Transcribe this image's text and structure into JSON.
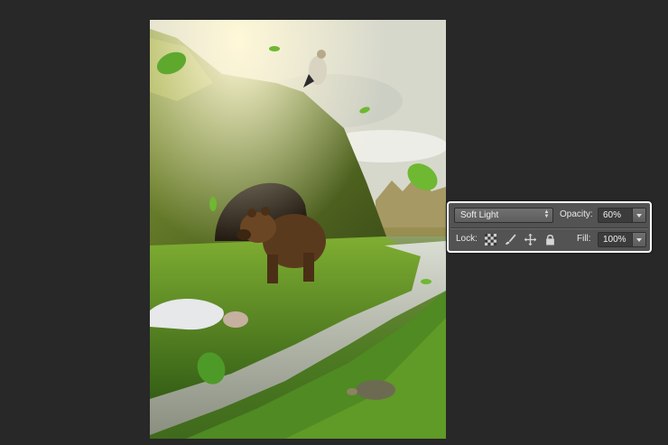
{
  "layers_panel": {
    "blend_mode": "Soft Light",
    "opacity_label": "Opacity:",
    "opacity_value": "60%",
    "lock_label": "Lock:",
    "fill_label": "Fill:",
    "fill_value": "100%",
    "lock_icons": [
      "transparency-lock-icon",
      "brush-lock-icon",
      "move-lock-icon",
      "padlock-icon"
    ]
  },
  "canvas_image": {
    "scene": [
      "mossy-rock-cave",
      "brown-bear",
      "bird-on-rock",
      "sleeping-child",
      "stream",
      "turtle",
      "falling-leaves"
    ]
  }
}
